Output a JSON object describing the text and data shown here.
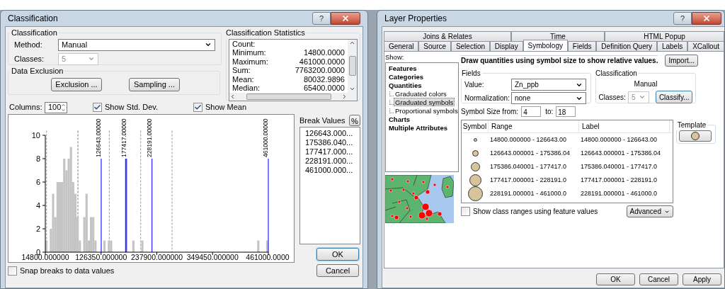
{
  "classification_window": {
    "title": "Classification",
    "help_button": "?",
    "classification": {
      "legend": "Classification",
      "method_label": "Method:",
      "method": "Manual",
      "classes_label": "Classes:",
      "classes": "5",
      "classes_disabled": true
    },
    "data_exclusion": {
      "legend": "Data Exclusion",
      "buttons": [
        "Exclusion ...",
        "Sampling ..."
      ]
    },
    "statistics": {
      "legend": "Classification Statistics",
      "rows": [
        {
          "label": "Count:"
        },
        {
          "label": "Minimum:",
          "value": "14800.0000"
        },
        {
          "label": "Maximum:",
          "value": "461000.0000"
        },
        {
          "label": "Sum:",
          "value": "7763200.0000"
        },
        {
          "label": "Mean:",
          "value": "80032.9896"
        },
        {
          "label": "Median:",
          "value": "65400.0000"
        }
      ]
    },
    "columns": {
      "label": "Columns:",
      "value": "100"
    },
    "checkboxes": [
      {
        "label": "Show Std. Dev.",
        "checked": true
      },
      {
        "label": "Show Mean",
        "checked": true
      }
    ],
    "histogram": {
      "chart_data": {
        "type": "bar",
        "xlim": [
          14800,
          461000
        ],
        "ylim": [
          0,
          10
        ],
        "yticks": [
          0,
          2,
          4,
          6,
          8,
          10
        ],
        "xticks": [
          {
            "value": 14800,
            "label": "14800.000000"
          },
          {
            "value": 126350,
            "label": "126350.000000"
          },
          {
            "value": 237900,
            "label": "237900.000000"
          },
          {
            "value": 349450,
            "label": "349450.000000"
          },
          {
            "value": 461000,
            "label": "461000.0000"
          }
        ],
        "x": [
          17031,
          25955,
          30417,
          34879,
          39341,
          43803,
          48265,
          52727,
          57189,
          61651,
          66113,
          70575,
          75037,
          79499,
          83961,
          92885,
          97347,
          101809,
          106271,
          110733,
          115195,
          133043,
          141967,
          146429,
          191049,
          208897,
          440921,
          458769
        ],
        "values": [
          1,
          2,
          5,
          3,
          6,
          6,
          6,
          8,
          7,
          8,
          9,
          6,
          5,
          3,
          1,
          3,
          5,
          1,
          3,
          3,
          1,
          1,
          1,
          1,
          1,
          1,
          1,
          1
        ],
        "ref_lines": [
          {
            "axis": "x",
            "value": 126643,
            "label": "126643.00000",
            "color": "#2020ff"
          },
          {
            "axis": "x",
            "value": 175386.04,
            "color": "#2020ff"
          },
          {
            "axis": "x",
            "value": 177417,
            "label": "177417.00000",
            "color": "#2020ff"
          },
          {
            "axis": "x",
            "value": 228191,
            "label": "228191.00000",
            "color": "#2020ff"
          },
          {
            "axis": "x",
            "value": 461000,
            "label": "461000.00000",
            "color": "#2020ff"
          },
          {
            "axis": "x",
            "value": 80033,
            "color": "#777777"
          },
          {
            "axis": "x",
            "value": 17233,
            "color": "#999999"
          },
          {
            "axis": "x",
            "value": 142833,
            "color": "#999999"
          },
          {
            "axis": "x",
            "value": 205633,
            "color": "#999999"
          },
          {
            "axis": "x",
            "value": 268433,
            "color": "#999999"
          }
        ]
      }
    },
    "break_values": {
      "label": "Break Values",
      "percent_button": "%",
      "values": [
        "126643.000...",
        "175386.040...",
        "177417.000...",
        "228191.000...",
        "461000.000..."
      ]
    },
    "buttons": [
      "OK",
      "Cancel"
    ],
    "snap": {
      "label": "Snap breaks to data values",
      "checked": false
    }
  },
  "layer_properties_window": {
    "title": "Layer Properties",
    "help_button": "?",
    "tab_rows": [
      [
        {
          "label": "Joins & Relates",
          "selected": false
        },
        {
          "label": "Time",
          "selected": false
        },
        {
          "label": "HTML Popup",
          "selected": false
        }
      ],
      [
        {
          "label": "General",
          "selected": false
        },
        {
          "label": "Source",
          "selected": false
        },
        {
          "label": "Selection",
          "selected": false
        },
        {
          "label": "Display",
          "selected": false
        },
        {
          "label": "Symbology",
          "selected": true
        },
        {
          "label": "Fields",
          "selected": false
        },
        {
          "label": "Definition Query",
          "selected": false
        },
        {
          "label": "Labels",
          "selected": false
        },
        {
          "label": "XCallout",
          "selected": false
        }
      ]
    ],
    "show": {
      "label": "Show:",
      "tree": [
        {
          "label": "Features",
          "selected": false
        },
        {
          "label": "Categories",
          "selected": false
        },
        {
          "label": "Quantities",
          "selected": false,
          "children": [
            {
              "label": "Graduated colors",
              "selected": false
            },
            {
              "label": "Graduated symbols",
              "selected": true
            },
            {
              "label": "Proportional symbols",
              "selected": false
            }
          ]
        },
        {
          "label": "Charts",
          "selected": false
        },
        {
          "label": "Multiple Attributes",
          "selected": false
        }
      ]
    },
    "description": "Draw quantities using symbol size to show relative values.",
    "import_button": "Import...",
    "fields": {
      "legend": "Fields",
      "value_label": "Value:",
      "value": "Zn_ppb",
      "normalization_label": "Normalization:",
      "normalization": "none"
    },
    "classification": {
      "legend": "Classification",
      "method": "Manual",
      "classes_label": "Classes:",
      "classes": "5",
      "classes_disabled": true,
      "classify_button": "Classify..."
    },
    "symbol_size": {
      "from_label": "Symbol Size from:",
      "from": "4",
      "to_label": "to:",
      "to": "18"
    },
    "table": {
      "columns": [
        "Symbol",
        "Range",
        "Label"
      ],
      "rows": [
        {
          "range": "14800.000000 - 126643.00",
          "label": "14800.000000 - 126643.00"
        },
        {
          "range": "126643.000001 - 175386.04",
          "label": "126643.000001 - 175386.04"
        },
        {
          "range": "175386.040001 - 177417.0",
          "label": "175386.040001 - 177417.0"
        },
        {
          "range": "177417.000001 - 228191.0",
          "label": "177417.000001 - 228191.0"
        },
        {
          "range": "228191.000001 - 461000.0",
          "label": "228191.000001 - 461000.0"
        }
      ]
    },
    "template": {
      "legend": "Template"
    },
    "show_class_ranges": {
      "label": "Show class ranges using feature values",
      "checked": false
    },
    "advanced_button": "Advanced",
    "buttons": [
      "OK",
      "Cancel",
      "Apply"
    ]
  }
}
